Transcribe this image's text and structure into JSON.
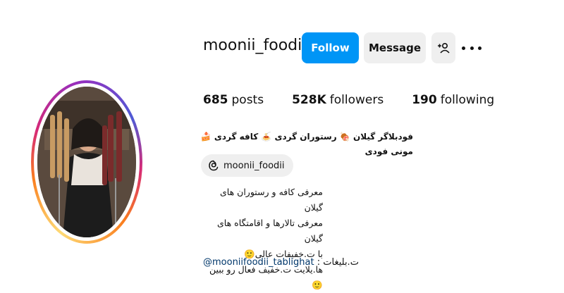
{
  "profile": {
    "username": "moonii_foodii",
    "follow_label": "Follow",
    "message_label": "Message"
  },
  "stats": {
    "posts_count": "685",
    "posts_label": "posts",
    "followers_count": "528K",
    "followers_label": "followers",
    "following_count": "190",
    "following_label": "following"
  },
  "bio": {
    "headline_line1": "فودبلاگر گیلان 🍖 رستوران گردی 🍝 کافه گردی 🍰 مونی فودی",
    "threads_handle": "moonii_foodii",
    "lines": [
      "معرفی کافه و رستوران های گیلان",
      "معرفی تالارها و اقامتگاه های گیلان",
      "با ت.خفیفات عالی🙂",
      "ها.یلایت ت.خفیف فعال رو ببین🙂"
    ],
    "ads_prefix": "ت.بلیغات :",
    "ads_link": "@mooniifoodii_tablighat"
  },
  "colors": {
    "follow_button": "#0095f6",
    "secondary_button": "#efefef",
    "link": "#00376b",
    "ring_gradient": [
      "#feda75",
      "#fa7e1e",
      "#d62976",
      "#962fbf",
      "#4f5bd5"
    ]
  },
  "icons": {
    "suggest": "add-person-icon",
    "more": "more-options-icon",
    "threads": "threads-icon"
  }
}
